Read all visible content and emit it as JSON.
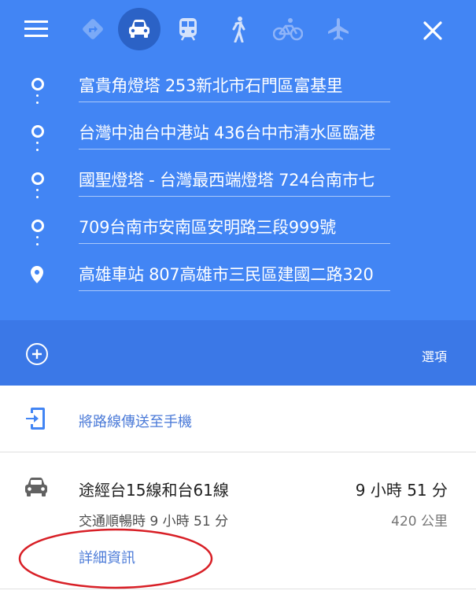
{
  "icons": {
    "menu": "menu-icon",
    "best": "directions-diamond-icon",
    "driving": "car-icon",
    "transit": "train-icon",
    "walking": "walking-icon",
    "cycling": "bicycle-icon",
    "flight": "airplane-icon",
    "close": "close-icon",
    "add": "add-circle-icon",
    "send": "phone-send-icon"
  },
  "colors": {
    "header_blue": "#4285f4",
    "bar_blue": "#3b78e7",
    "active_mode": "#2b62c6",
    "link_blue": "#4c7bd8",
    "annotation_red": "#d81f26"
  },
  "waypoints": [
    {
      "text": "富貴角燈塔 253新北市石門區富基里"
    },
    {
      "text": "台灣中油台中港站 436台中市清水區臨港"
    },
    {
      "text": "國聖燈塔 - 台灣最西端燈塔 724台南市七"
    },
    {
      "text": "709台南市安南區安明路三段999號"
    },
    {
      "text": "高雄車站 807高雄市三民區建國二路320"
    }
  ],
  "options_label": "選項",
  "send_to_phone": "將路線傳送至手機",
  "route": {
    "via": "途經台15線和台61線",
    "duration": "9 小時 51 分",
    "traffic": "交通順暢時 9 小時 51 分",
    "distance": "420 公里",
    "details": "詳細資訊"
  }
}
